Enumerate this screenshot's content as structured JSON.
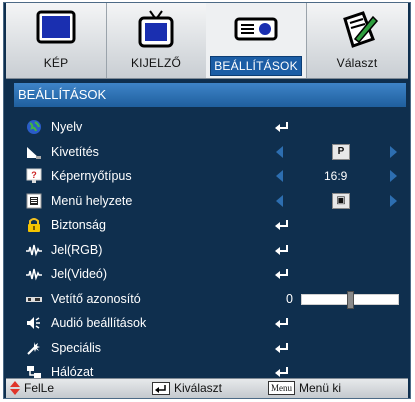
{
  "tabs": [
    {
      "label": "KÉP",
      "icon": "monitor-icon"
    },
    {
      "label": "KIJELZŐ",
      "icon": "tv-icon"
    },
    {
      "label": "BEÁLLÍTÁSOK",
      "icon": "projector-icon",
      "active": true
    },
    {
      "label": "Választ",
      "icon": "notepad-icon"
    }
  ],
  "section_title": "BEÁLLÍTÁSOK",
  "menu": [
    {
      "label": "Nyelv",
      "icon": "globe-icon",
      "control": "enter"
    },
    {
      "label": "Kivetítés",
      "icon": "projection-icon",
      "control": "select",
      "value": "P"
    },
    {
      "label": "Képernyőtípus",
      "icon": "screen-type-icon",
      "control": "select",
      "value": "16:9"
    },
    {
      "label": "Menü helyzete",
      "icon": "menu-location-icon",
      "control": "select",
      "value": "▣"
    },
    {
      "label": "Biztonság",
      "icon": "lock-icon",
      "control": "enter"
    },
    {
      "label": "Jel(RGB)",
      "icon": "signal-icon",
      "control": "enter"
    },
    {
      "label": "Jel(Videó)",
      "icon": "signal-icon",
      "control": "enter"
    },
    {
      "label": "Vetítő azonosító",
      "icon": "projector-id-icon",
      "control": "slider",
      "value": "0",
      "level": 0.5
    },
    {
      "label": "Audió beállítások",
      "icon": "speaker-icon",
      "control": "enter"
    },
    {
      "label": "Speciális",
      "icon": "advanced-icon",
      "control": "enter"
    },
    {
      "label": "Hálózat",
      "icon": "network-icon",
      "control": "enter"
    }
  ],
  "bottom": {
    "nav": "FelLe",
    "select": "Kiválaszt",
    "menu_key": "Menu",
    "exit": "Menü ki"
  },
  "colors": {
    "background": "#0f2f4e",
    "header": "#2f74b8",
    "accent_arrows": "#2d6eb0",
    "nav_arrows": "#e0342a"
  }
}
